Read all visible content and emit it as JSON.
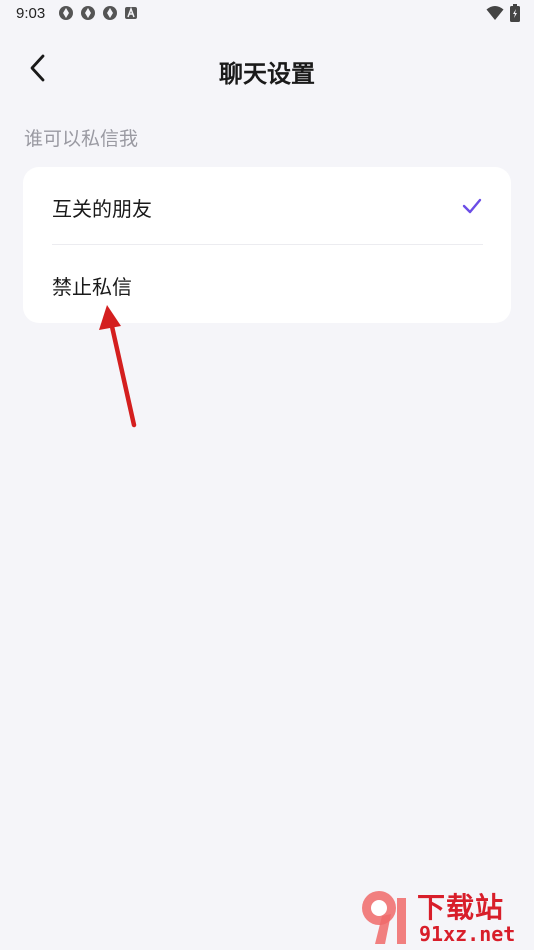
{
  "status_bar": {
    "time": "9:03",
    "icons_left": [
      "app-notification-icon",
      "app-notification-icon",
      "app-notification-icon",
      "font-a-icon"
    ],
    "icons_right": [
      "wifi-icon",
      "battery-charging-icon"
    ]
  },
  "header": {
    "title": "聊天设置"
  },
  "section": {
    "label": "谁可以私信我"
  },
  "options": [
    {
      "label": "互关的朋友",
      "selected": true
    },
    {
      "label": "禁止私信",
      "selected": false
    }
  ],
  "colors": {
    "background": "#f5f5f9",
    "card": "#ffffff",
    "accent_check": "#6b4de6",
    "section_label": "#9a9aa2",
    "annotation_arrow": "#d41f1f"
  },
  "watermark": {
    "title": "下载站",
    "url": "91xz.net"
  }
}
